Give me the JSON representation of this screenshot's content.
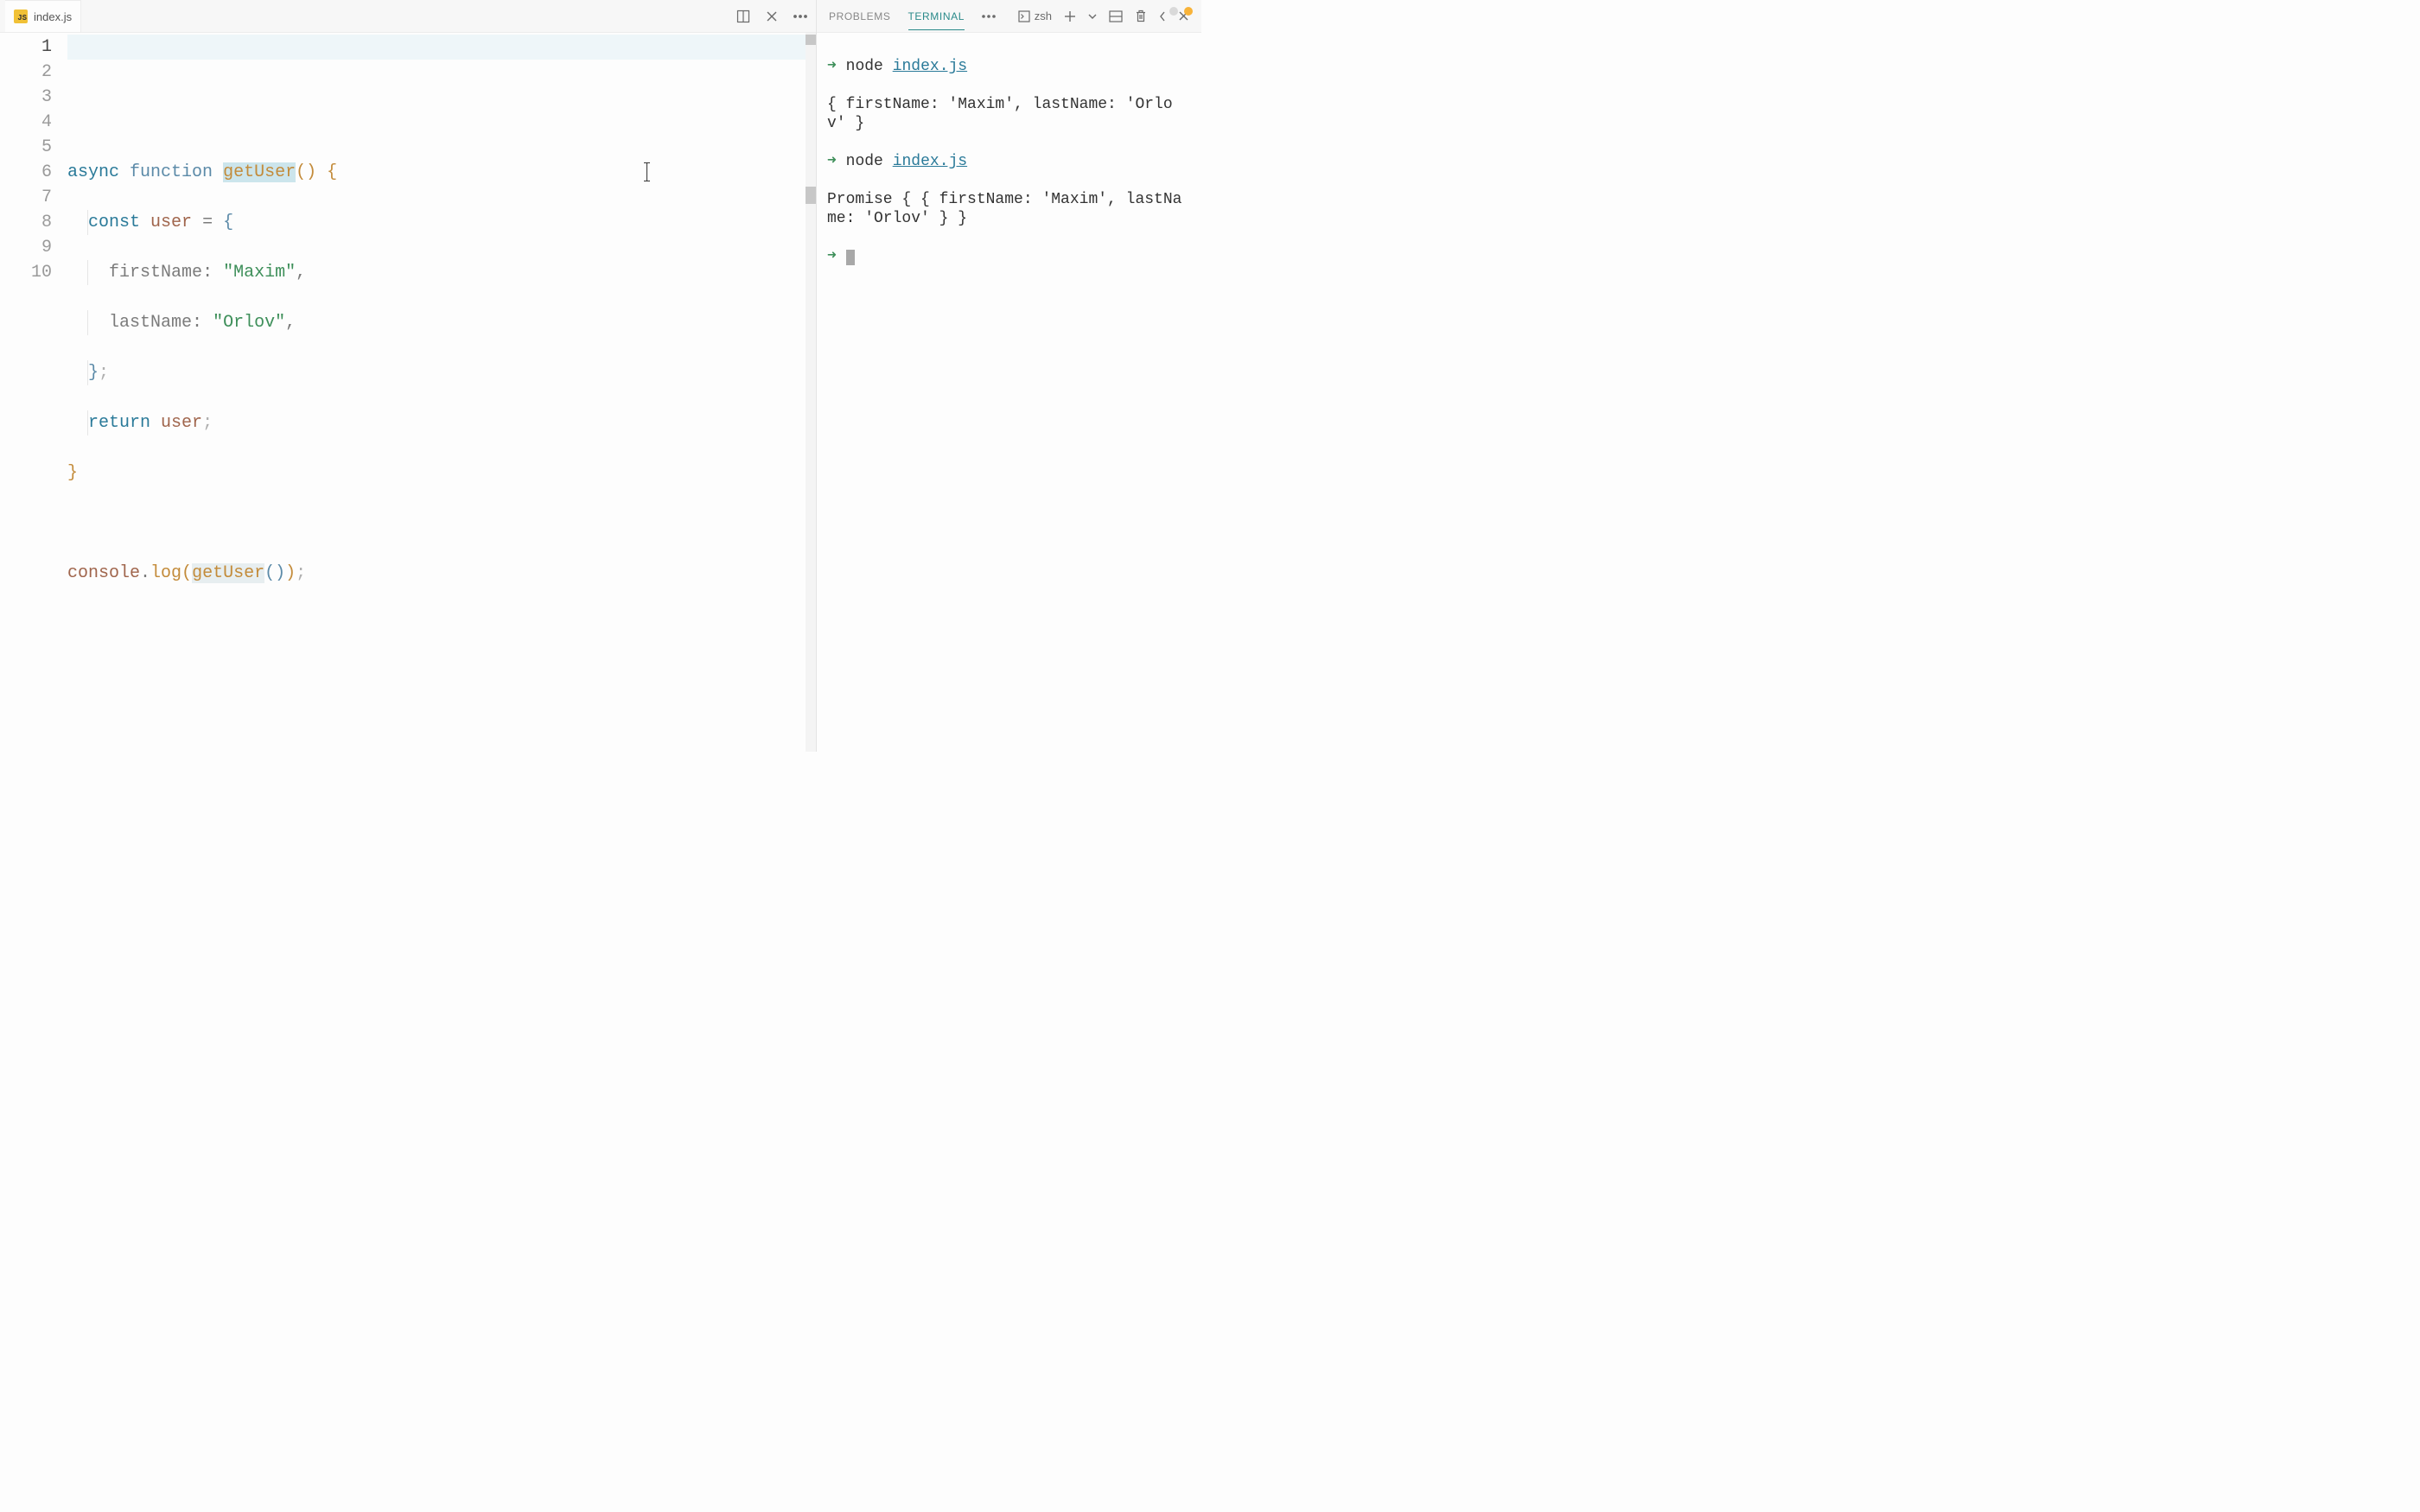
{
  "editor": {
    "file_name": "index.js",
    "line_numbers": [
      "1",
      "2",
      "3",
      "4",
      "5",
      "6",
      "7",
      "8",
      "9",
      "10"
    ],
    "current_line_index": 0,
    "code": {
      "l1": {
        "async": "async",
        "function": "function",
        "name": "getUser",
        "p1": "(",
        "p2": ")",
        "ob": "{"
      },
      "l2": {
        "const": "const",
        "ident": "user",
        "eq": "=",
        "ob": "{"
      },
      "l3": {
        "key": "firstName",
        "colon": ":",
        "val": "\"Maxim\"",
        "comma": ","
      },
      "l4": {
        "key": "lastName",
        "colon": ":",
        "val": "\"Orlov\"",
        "comma": ","
      },
      "l5": {
        "cb": "}",
        "semi": ";"
      },
      "l6": {
        "return": "return",
        "ident": "user",
        "semi": ";"
      },
      "l7": {
        "cb": "}"
      },
      "l9": {
        "console": "console",
        "dot": ".",
        "log": "log",
        "p1": "(",
        "call": "getUser",
        "p2": "(",
        "p3": ")",
        "p4": ")",
        "semi": ";"
      }
    }
  },
  "terminal": {
    "tabs": {
      "problems": "PROBLEMS",
      "terminal": "TERMINAL"
    },
    "shell_name": "zsh",
    "lines": {
      "cmd1_node": "node",
      "cmd1_file": "index.js",
      "out1": "{ firstName: 'Maxim', lastName: 'Orlov' }",
      "cmd2_node": "node",
      "cmd2_file": "index.js",
      "out2": "Promise { { firstName: 'Maxim', lastName: 'Orlov' } }"
    }
  }
}
